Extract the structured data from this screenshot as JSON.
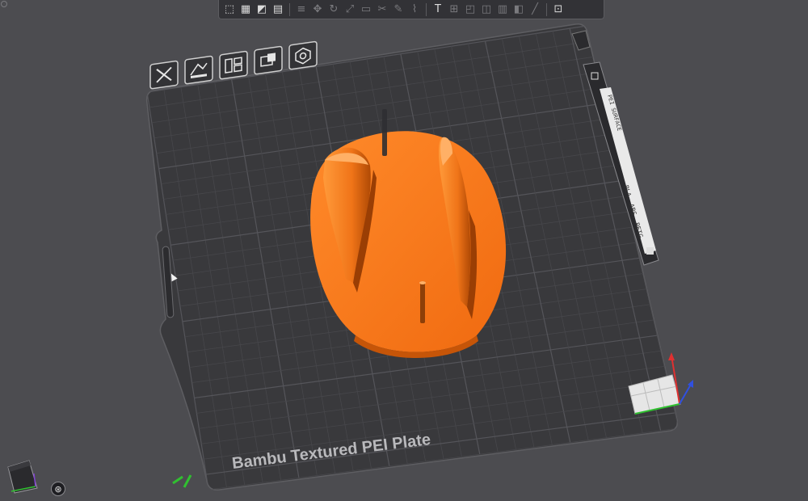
{
  "plate": {
    "name": "Bambu Textured PEI Plate",
    "side_label_upper": "PEI SURFACE",
    "side_label_lower": "PLA, ABS, PETG"
  },
  "toolbar": {
    "buttons": [
      {
        "name": "add-cube-icon",
        "glyph": "⬚",
        "dim": false
      },
      {
        "name": "arrange-icon",
        "glyph": "▦",
        "dim": false
      },
      {
        "name": "orient-icon",
        "glyph": "◩",
        "dim": false
      },
      {
        "name": "plate-settings-icon",
        "glyph": "▤",
        "dim": false
      },
      {
        "name": "layers-icon",
        "glyph": "≡",
        "dim": true
      },
      {
        "name": "move-icon",
        "glyph": "✥",
        "dim": true
      },
      {
        "name": "rotate-icon",
        "glyph": "↻",
        "dim": true
      },
      {
        "name": "scale-icon",
        "glyph": "⤢",
        "dim": true
      },
      {
        "name": "lay-on-face-icon",
        "glyph": "▭",
        "dim": true
      },
      {
        "name": "cut-icon",
        "glyph": "✂",
        "dim": true
      },
      {
        "name": "support-paint-icon",
        "glyph": "✎",
        "dim": true
      },
      {
        "name": "seam-paint-icon",
        "glyph": "⌇",
        "dim": true
      },
      {
        "name": "text-icon",
        "glyph": "T",
        "dim": false
      },
      {
        "name": "measure-icon",
        "glyph": "⊞",
        "dim": true
      },
      {
        "name": "assembly-icon",
        "glyph": "◰",
        "dim": true
      },
      {
        "name": "boolean-icon",
        "glyph": "◫",
        "dim": true
      },
      {
        "name": "variable-layer-icon",
        "glyph": "▥",
        "dim": true
      },
      {
        "name": "color-paint-icon",
        "glyph": "◧",
        "dim": true
      },
      {
        "name": "brim-ears-icon",
        "glyph": "╱",
        "dim": true
      },
      {
        "name": "view-settings-icon",
        "glyph": "⊡",
        "dim": false
      }
    ]
  },
  "colors": {
    "background": "#4c4c50",
    "plate": "#3a3a3d",
    "grid_line": "#4a4a4e",
    "model": "#ff7a1a",
    "model_shadow": "#cf5a08",
    "axis_x": "#e03030",
    "axis_y": "#30c030",
    "axis_z": "#3050e0"
  }
}
